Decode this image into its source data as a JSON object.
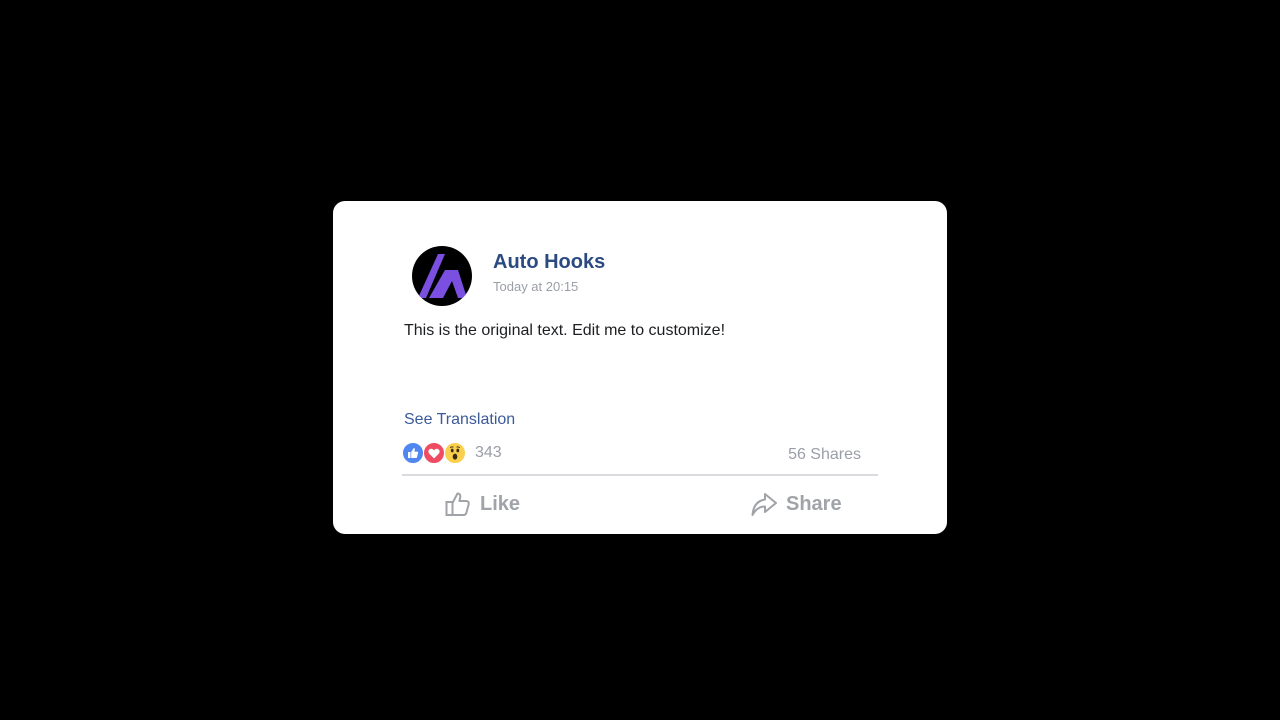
{
  "post": {
    "author": "Auto Hooks",
    "timestamp": "Today at 20:15",
    "text": "This is the original text. Edit me to customize!",
    "see_translation": "See Translation"
  },
  "engagement": {
    "reaction_count": "343",
    "shares": "56 Shares",
    "reaction_icons": [
      "like-reaction-icon",
      "love-reaction-icon",
      "wow-reaction-icon"
    ]
  },
  "actions": {
    "like_label": "Like",
    "share_label": "Share"
  },
  "colors": {
    "background": "#000000",
    "card": "#ffffff",
    "author": "#2b4a80",
    "link": "#3b5a9a",
    "muted": "#9a9ea6",
    "avatar_logo": "#7b4fe0",
    "like_reaction": "#4f86f0",
    "love_reaction": "#ef4c63",
    "wow_reaction": "#f9cf4b"
  }
}
